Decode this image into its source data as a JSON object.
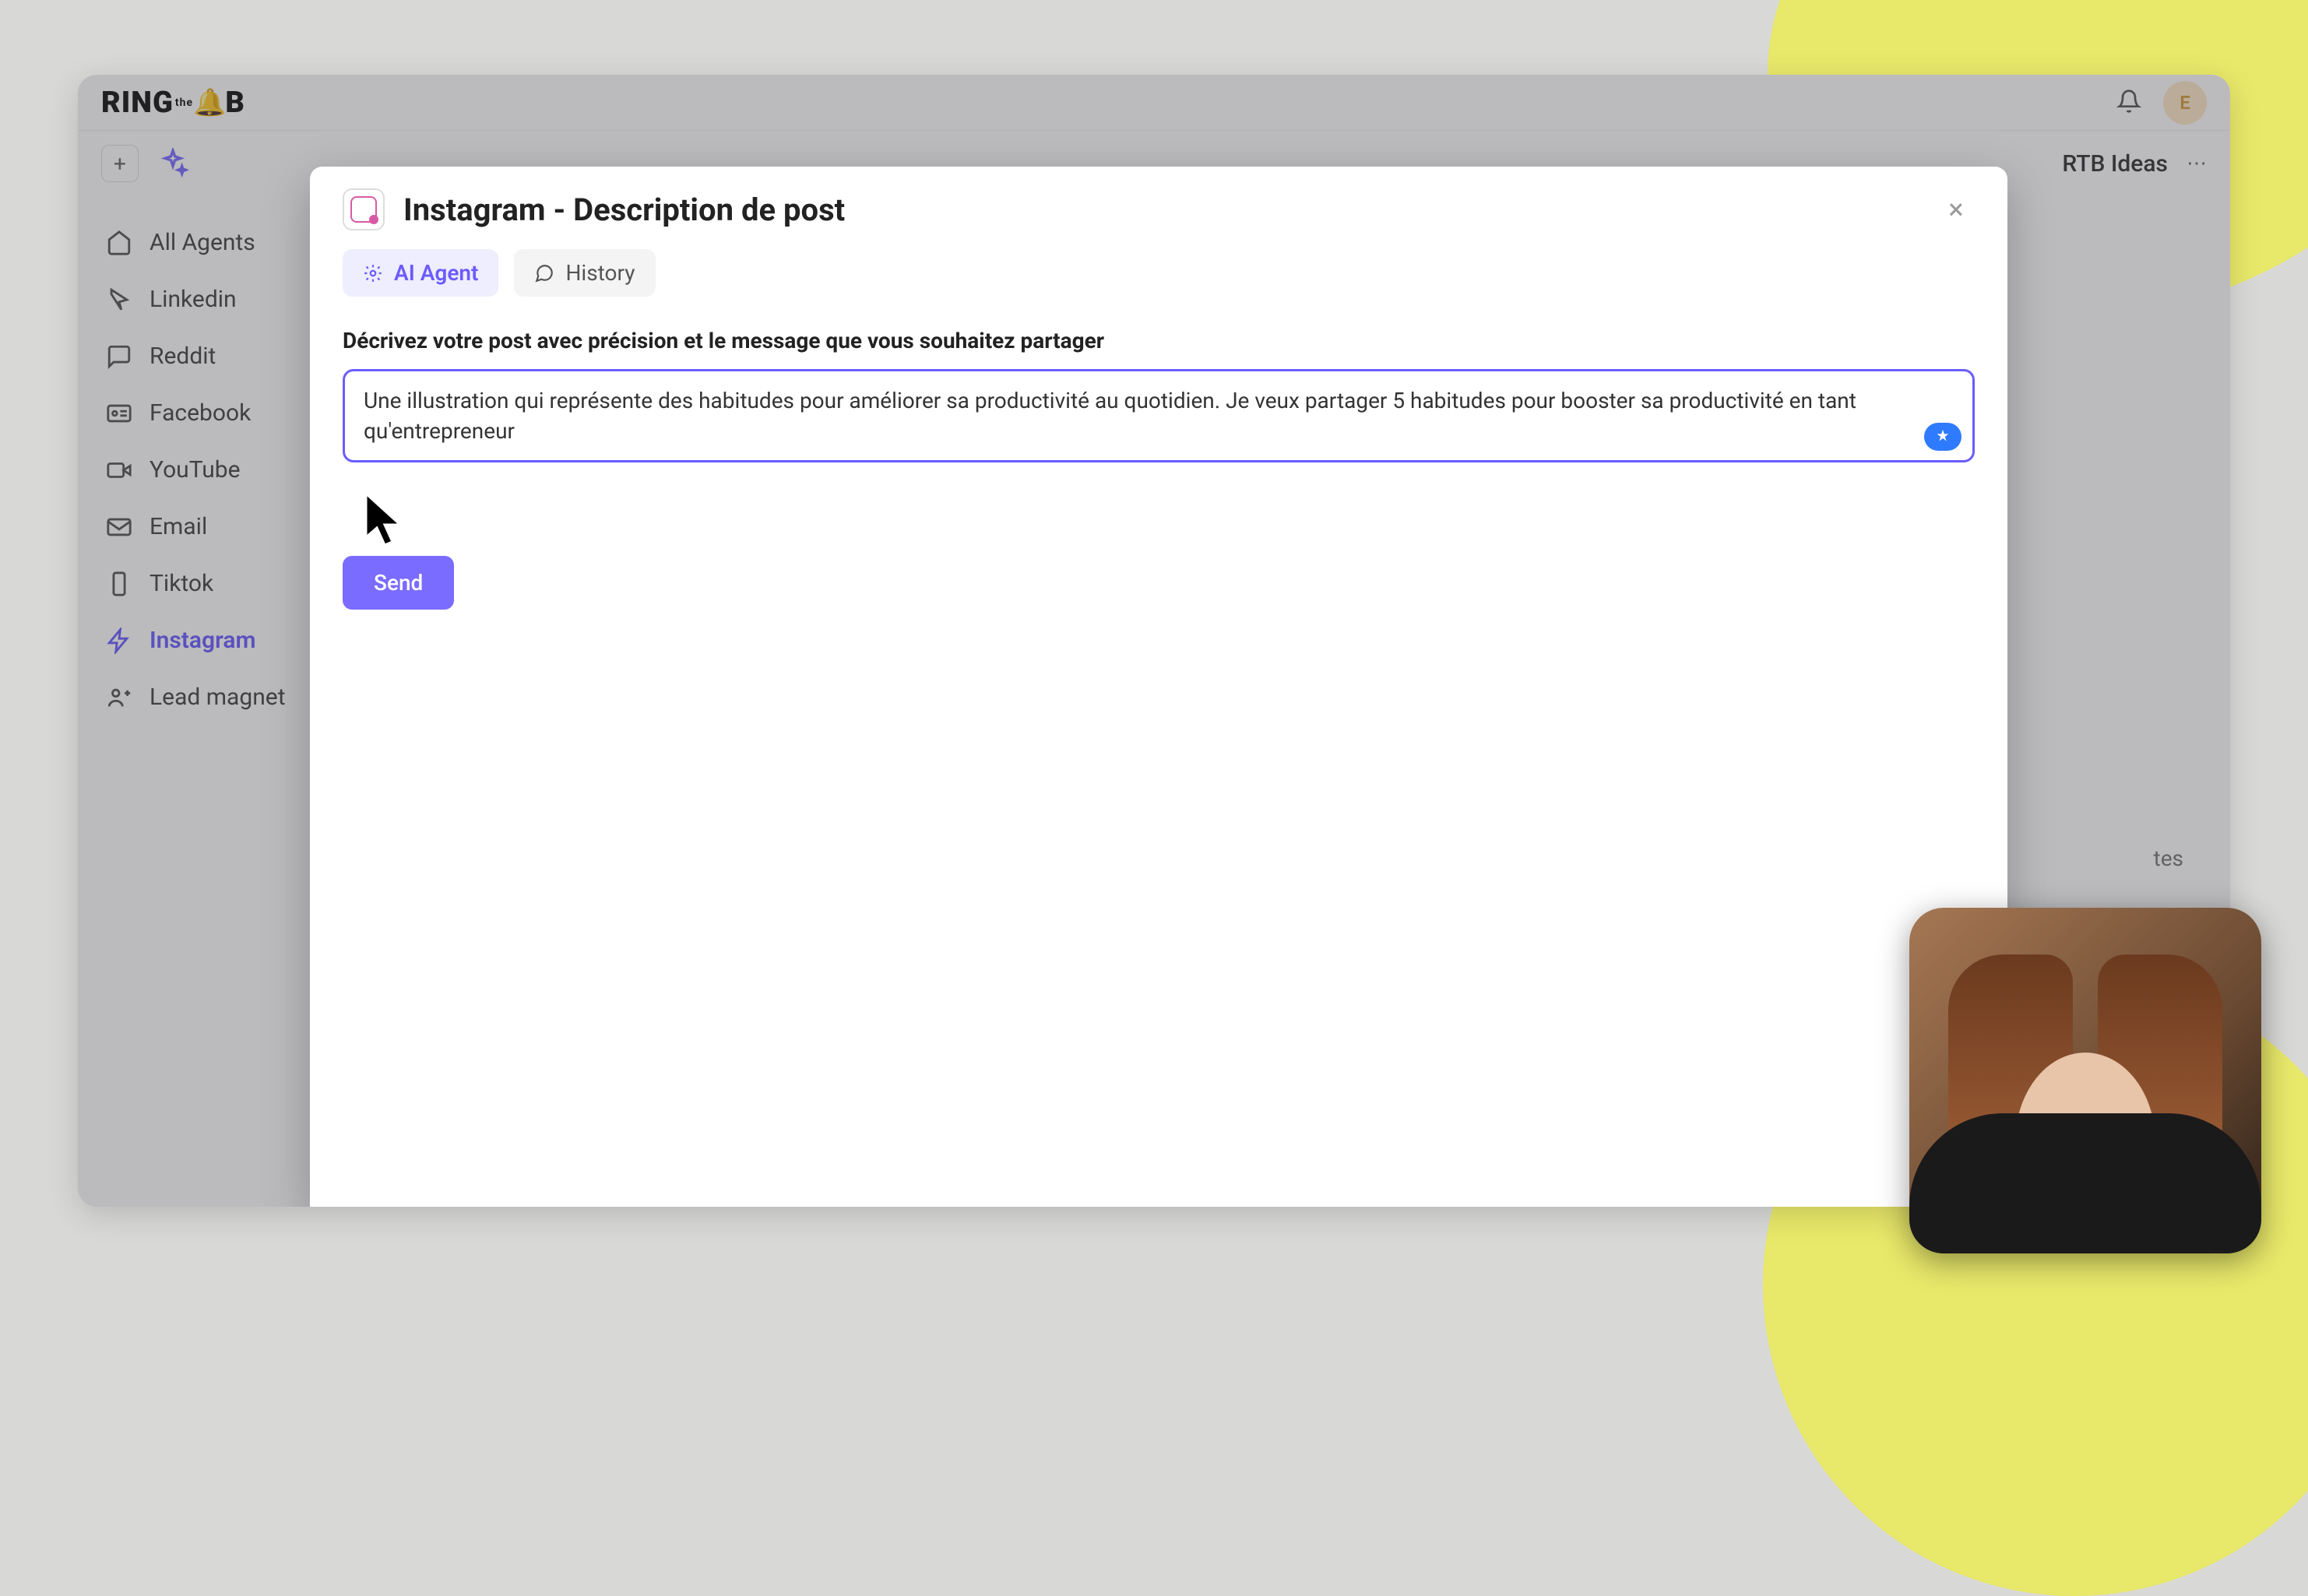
{
  "logo": {
    "part1": "RING",
    "sub": "the",
    "part2": "B"
  },
  "topbar": {
    "avatar_initial": "E"
  },
  "secondbar": {
    "rtb_label": "RTB Ideas"
  },
  "sidebar": {
    "items": [
      {
        "label": "All Agents"
      },
      {
        "label": "Linkedin"
      },
      {
        "label": "Reddit"
      },
      {
        "label": "Facebook"
      },
      {
        "label": "YouTube"
      },
      {
        "label": "Email"
      },
      {
        "label": "Tiktok"
      },
      {
        "label": "Instagram"
      },
      {
        "label": "Lead magnet"
      }
    ]
  },
  "right_trunc": "tes",
  "modal": {
    "title": "Instagram - Description de post",
    "tabs": {
      "ai_agent": "AI Agent",
      "history": "History"
    },
    "form_label": "Décrivez votre post avec précision et le message que vous souhaitez partager",
    "textarea_value": "Une illustration qui représente des habitudes pour améliorer sa productivité au quotidien. Je veux partager 5 habitudes pour booster sa productivité en tant qu'entrepreneur",
    "send_label": "Send"
  }
}
